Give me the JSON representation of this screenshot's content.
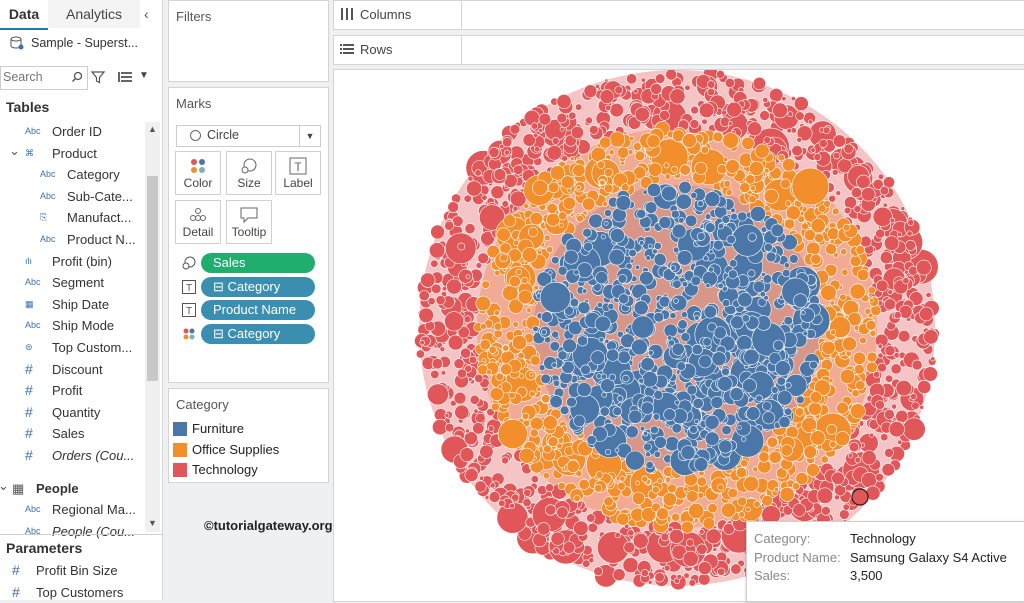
{
  "tabs": {
    "data": "Data",
    "analytics": "Analytics"
  },
  "datasource": {
    "name": "Sample - Superst..."
  },
  "search": {
    "placeholder": "Search"
  },
  "tables_header": "Tables",
  "fields": [
    {
      "type": "Abc",
      "label": "Order ID",
      "indent": 2
    },
    {
      "type": "hier",
      "label": "Product",
      "indent": 2,
      "expand": true
    },
    {
      "type": "Abc",
      "label": "Category",
      "indent": 3
    },
    {
      "type": "Abc",
      "label": "Sub-Cate...",
      "indent": 3
    },
    {
      "type": "clip",
      "label": "Manufact...",
      "indent": 3
    },
    {
      "type": "Abc",
      "label": "Product N...",
      "indent": 3
    },
    {
      "type": "bin",
      "label": "Profit (bin)",
      "indent": 2
    },
    {
      "type": "Abc",
      "label": "Segment",
      "indent": 2
    },
    {
      "type": "date",
      "label": "Ship Date",
      "indent": 2
    },
    {
      "type": "Abc",
      "label": "Ship Mode",
      "indent": 2
    },
    {
      "type": "set",
      "label": "Top Custom...",
      "indent": 2
    },
    {
      "type": "#",
      "label": "Discount",
      "indent": 2
    },
    {
      "type": "#",
      "label": "Profit",
      "indent": 2
    },
    {
      "type": "#",
      "label": "Quantity",
      "indent": 2
    },
    {
      "type": "#",
      "label": "Sales",
      "indent": 2
    },
    {
      "type": "#",
      "label": "Orders (Cou...",
      "indent": 2,
      "italic": true
    }
  ],
  "people": {
    "header": "People",
    "fields": [
      {
        "type": "Abc",
        "label": "Regional Ma..."
      },
      {
        "type": "Abc",
        "label": "People (Cou..."
      }
    ]
  },
  "parameters": {
    "header": "Parameters",
    "items": [
      "Profit Bin Size",
      "Top Customers"
    ]
  },
  "filters": {
    "title": "Filters"
  },
  "marks": {
    "title": "Marks",
    "type": "Circle",
    "buttons": [
      "Color",
      "Size",
      "Label",
      "Detail",
      "Tooltip"
    ],
    "pills": [
      {
        "icon": "size",
        "label": "Sales",
        "color": "#1fae6e"
      },
      {
        "icon": "label",
        "label": "⊟ Category",
        "color": "#3a8fb0"
      },
      {
        "icon": "label",
        "label": "Product Name",
        "color": "#3a8fb0"
      },
      {
        "icon": "color",
        "label": "⊟ Category",
        "color": "#3a8fb0"
      }
    ]
  },
  "legend": {
    "title": "Category",
    "items": [
      {
        "label": "Furniture",
        "color": "#4a77a8"
      },
      {
        "label": "Office Supplies",
        "color": "#f28e2b"
      },
      {
        "label": "Technology",
        "color": "#e15759"
      }
    ]
  },
  "watermark": "©tutorialgateway.org",
  "shelves": {
    "columns": "Columns",
    "rows": "Rows"
  },
  "tooltip": {
    "rows": [
      {
        "key": "Category:",
        "value": "Technology"
      },
      {
        "key": "Product Name:",
        "value": "Samsung Galaxy S4 Active"
      },
      {
        "key": "Sales:",
        "value": "3,500"
      }
    ]
  }
}
